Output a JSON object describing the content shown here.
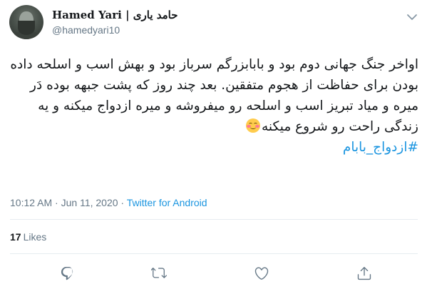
{
  "tweet": {
    "author": {
      "display_name": "𝐇amed Yari | حامد یاری",
      "handle": "@hamedyari10"
    },
    "body": {
      "text": "اواخر جنگ جهانی دوم بود و بابابزرگم سرباز بود و بهش اسب و اسلحه داده بودن برای حفاظت از هجوم متفقین. بعد چند روز که پشت جبهه بوده دَر میره و میاد تبریز اسب و اسلحه رو میفروشه و میره ازدواج میکنه و یه زندگی راحت رو شروع میکنه",
      "hashtag": "#ازدواج_بابام"
    },
    "meta": {
      "time": "10:12 AM",
      "separator": "·",
      "date": "Jun 11, 2020",
      "source": "Twitter for Android"
    },
    "stats": {
      "likes_count": "17",
      "likes_label": "Likes"
    },
    "icons": {
      "more": "chevron-down-icon",
      "reply": "reply-icon",
      "retweet": "retweet-icon",
      "like": "heart-icon",
      "share": "share-icon",
      "emoji": "smiling-face-blush-emoji"
    },
    "colors": {
      "link": "#1b95e0",
      "secondary_text": "#657786",
      "divider": "#e6ecf0"
    }
  }
}
